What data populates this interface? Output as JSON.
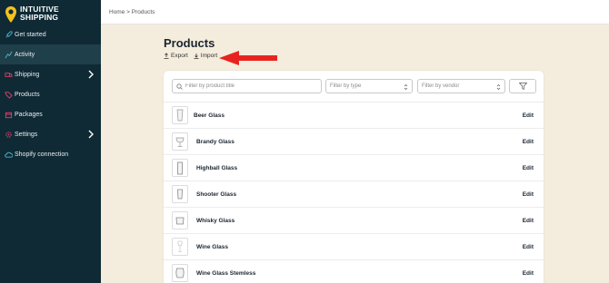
{
  "brand": {
    "line1": "INTUITIVE",
    "line2": "SHIPPING"
  },
  "sidebar": {
    "items": [
      {
        "label": "Get started",
        "icon": "rocket-icon"
      },
      {
        "label": "Activity",
        "icon": "activity-icon",
        "active": true
      },
      {
        "label": "Shipping",
        "icon": "truck-icon",
        "has_children": true
      },
      {
        "label": "Products",
        "icon": "tag-icon"
      },
      {
        "label": "Packages",
        "icon": "box-icon"
      },
      {
        "label": "Settings",
        "icon": "gear-icon",
        "has_children": true
      },
      {
        "label": "Shopify connection",
        "icon": "cloud-icon"
      }
    ]
  },
  "breadcrumb": "Home > Products",
  "page": {
    "title": "Products",
    "export_label": "Export",
    "import_label": "Import"
  },
  "filters": {
    "search_placeholder": "Filter by product title",
    "type_placeholder": "Filter by type",
    "vendor_placeholder": "Filter by vendor"
  },
  "products": [
    {
      "name": "Beer Glass",
      "action": "Edit"
    },
    {
      "name": "Brandy Glass",
      "action": "Edit"
    },
    {
      "name": "Highball Glass",
      "action": "Edit"
    },
    {
      "name": "Shooter Glass",
      "action": "Edit"
    },
    {
      "name": "Whisky Glass",
      "action": "Edit"
    },
    {
      "name": "Wine Glass",
      "action": "Edit"
    },
    {
      "name": "Wine Glass Stemless",
      "action": "Edit"
    }
  ],
  "colors": {
    "sidebar": "#0f2a35",
    "sidebar_active": "#1f3f4a",
    "background": "#f4ecdc",
    "accent": "#f4c21f",
    "arrow": "#e8231f"
  }
}
